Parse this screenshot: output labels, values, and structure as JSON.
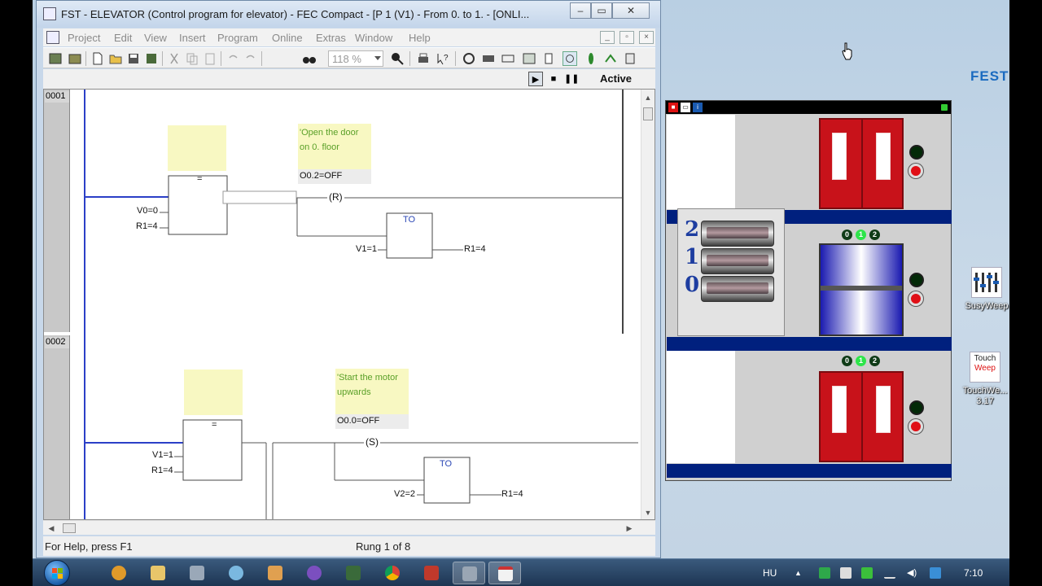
{
  "fst_window": {
    "title": "FST - ELEVATOR (Control program for elevator) - FEC Compact - [P  1 (V1) - From 0. to 1. - [ONLI...",
    "menu": [
      "Project",
      "Edit",
      "View",
      "Insert",
      "Program",
      "Online",
      "Extras",
      "Window",
      "Help"
    ],
    "zoom": "118 %",
    "status_mode": "Active",
    "statusbar": {
      "help": "For Help, press F1",
      "rung": "Rung 1 of 8"
    }
  },
  "rungs": [
    {
      "number": "0001",
      "compare_op": "=",
      "inputs": [
        "V0=0",
        "R1=4"
      ],
      "comment": "'Open the door\non 0. floor",
      "address": "O0.2=OFF",
      "coil": "(R)",
      "timer_label": "TO",
      "timer_input": "V1=1",
      "timer_output": "R1=4"
    },
    {
      "number": "0002",
      "compare_op": "=",
      "inputs": [
        "V1=1",
        "R1=4"
      ],
      "comment": "'Start the motor\nupwards",
      "address": "O0.0=OFF",
      "coil": "(S)",
      "timer_label": "TO",
      "timer_input": "V2=2",
      "timer_output": "R1=4"
    }
  ],
  "simulator": {
    "floor_numbers": [
      "2",
      "1",
      "0"
    ],
    "indicator_digits": [
      "0",
      "1",
      "2"
    ],
    "lit_indicator": "1"
  },
  "desktop": {
    "brand": "FEST",
    "icons": [
      {
        "label": "SusyWeep"
      },
      {
        "label": "TouchWe...\n3.17"
      }
    ],
    "touch_icon_text": [
      "Touch",
      "Weep"
    ]
  },
  "taskbar": {
    "language": "HU",
    "time": "7:10"
  },
  "colors": {
    "floor_bar": "#00207e",
    "door": "#c8121a",
    "ladder_rail": "#2b3fc7",
    "comment": "#5aa028",
    "comment_bg": "#f8f8c2"
  }
}
